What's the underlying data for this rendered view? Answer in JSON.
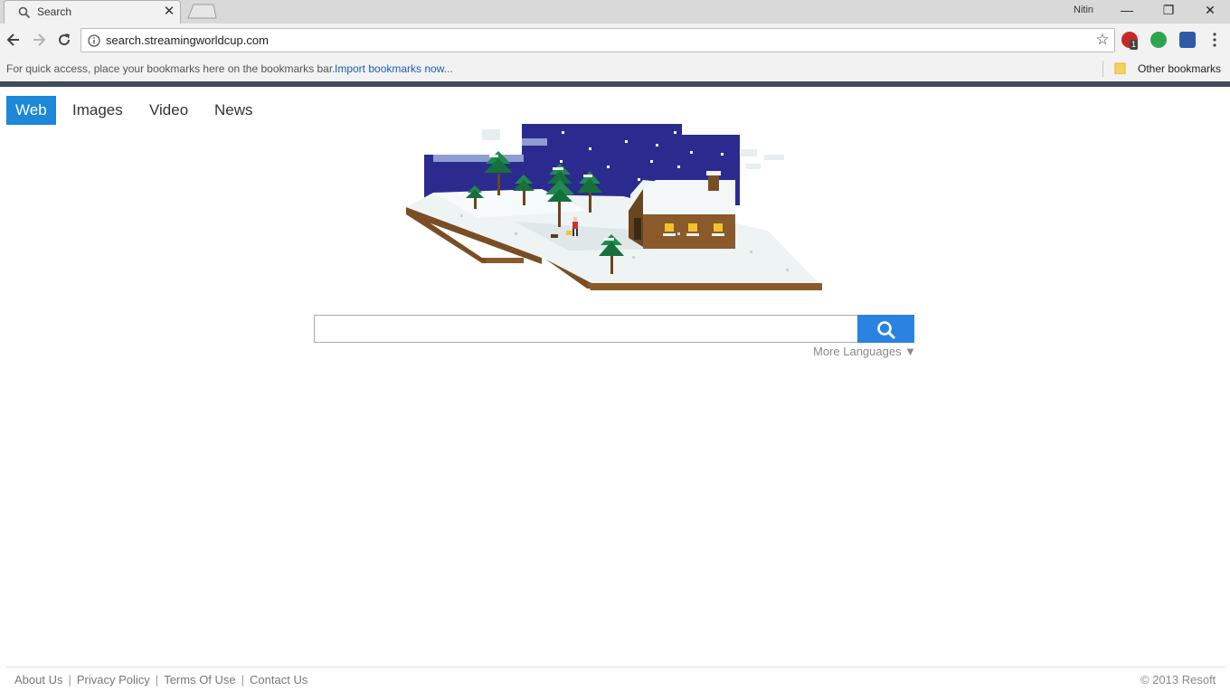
{
  "browser": {
    "tab_title": "Search",
    "tab_close": "✕",
    "profile_name": "Nitin",
    "window_controls": {
      "minimize": "—",
      "restore": "❐",
      "close": "✕"
    },
    "url": "search.streamingworldcup.com",
    "extensions": [
      {
        "name": "adblock-extension-icon",
        "badge": "1",
        "color": "#c62828"
      },
      {
        "name": "grammarly-extension-icon",
        "badge": "",
        "color": "#2ea44f"
      },
      {
        "name": "search-extension-icon",
        "badge": "",
        "color": "#2f5aa8"
      }
    ],
    "bookmarks_bar": {
      "hint": "For quick access, place your bookmarks here on the bookmarks bar.",
      "import_link": "Import bookmarks now...",
      "other_bookmarks": "Other bookmarks"
    }
  },
  "page": {
    "tabs": [
      {
        "label": "Web",
        "active": true
      },
      {
        "label": "Images",
        "active": false
      },
      {
        "label": "Video",
        "active": false
      },
      {
        "label": "News",
        "active": false
      }
    ],
    "search": {
      "value": "",
      "placeholder": "",
      "button_icon": "search-icon"
    },
    "more_languages": "More Languages ▼",
    "footer_links": [
      "About Us",
      "Privacy Policy",
      "Terms Of Use",
      "Contact Us"
    ],
    "copyright": "© 2013 Resoft"
  },
  "colors": {
    "accent": "#1e88d8",
    "search_button": "#2a83e0",
    "night_sky": "#2b2b8f",
    "snow": "#eef3f3",
    "house_brick": "#8a5a2b"
  }
}
